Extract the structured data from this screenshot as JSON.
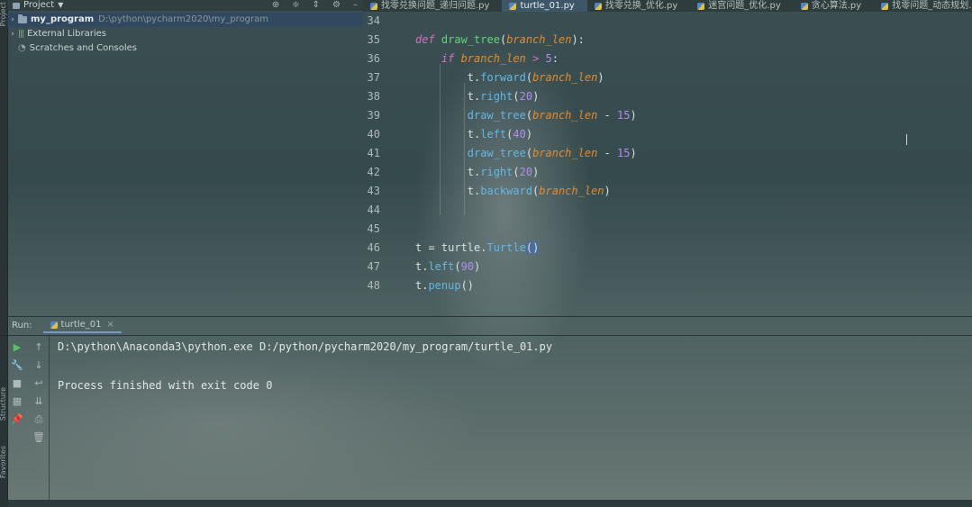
{
  "project_panel": {
    "header_title": "Project",
    "tree": [
      {
        "label": "my_program",
        "path": "D:\\python\\pycharm2020\\my_program"
      },
      {
        "label": "External Libraries"
      },
      {
        "label": "Scratches and Consoles"
      }
    ]
  },
  "side_stripes": {
    "project": "Project",
    "structure": "Structure",
    "favorites": "Favorites"
  },
  "editor": {
    "tabs": [
      {
        "label": "找零兑换问题_递归问题.py",
        "active": false
      },
      {
        "label": "turtle_01.py",
        "active": true
      },
      {
        "label": "找零兑换_优化.py",
        "active": false
      },
      {
        "label": "迷宫问题_优化.py",
        "active": false
      },
      {
        "label": "贪心算法.py",
        "active": false
      },
      {
        "label": "找零问题_动态规划.p",
        "active": false
      }
    ],
    "line_numbers": [
      "34",
      "35",
      "36",
      "37",
      "38",
      "39",
      "40",
      "41",
      "42",
      "43",
      "44",
      "45",
      "46",
      "47",
      "48"
    ]
  },
  "run_panel": {
    "label": "Run:",
    "tab": "turtle_01",
    "output": [
      "D:\\python\\Anaconda3\\python.exe D:/python/pycharm2020/my_program/turtle_01.py",
      "Process finished with exit code 0"
    ]
  },
  "colors": {
    "keyword": "#d86fc3",
    "function": "#5fd47d",
    "param": "#e38b2f",
    "method": "#64b7e6",
    "number": "#b48cf0",
    "run_icon": "#5cbf68"
  }
}
